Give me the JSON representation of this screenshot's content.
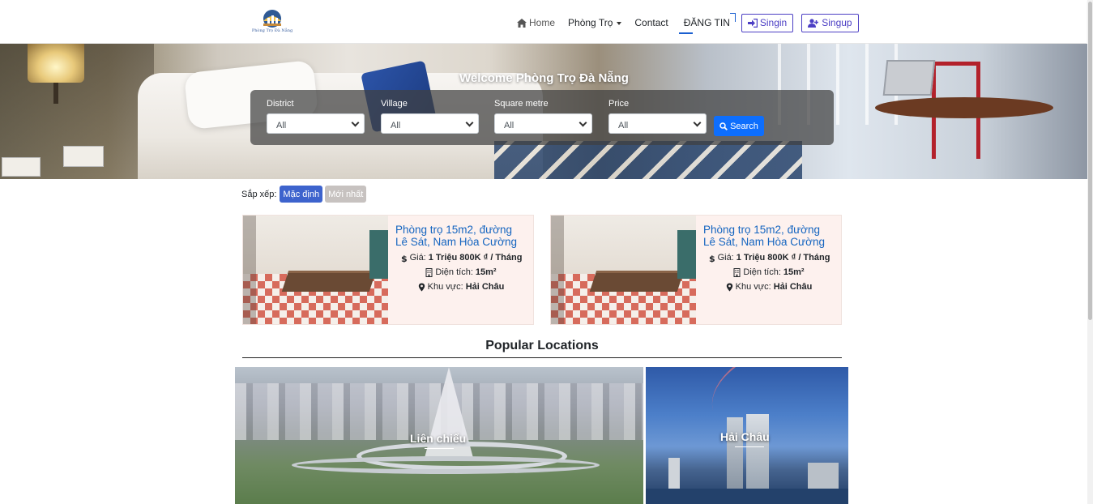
{
  "brand": {
    "logo_text": "Phòng Trọ Đà Nẵng",
    "accent": "#4c3fc4",
    "link_color": "#1565c0"
  },
  "nav": {
    "home": "Home",
    "phong_tro": "Phòng Trọ",
    "contact": "Contact",
    "dang_tin": "ĐĂNG TIN",
    "signin": "Singin",
    "signup": "Singup"
  },
  "hero": {
    "title": "Welcome Phòng Trọ Đà Nẵng",
    "search": {
      "district_label": "District",
      "district_value": "All",
      "village_label": "Village",
      "village_value": "All",
      "area_label": "Square metre",
      "area_value": "All",
      "price_label": "Price",
      "price_value": "All",
      "button_label": "Search"
    }
  },
  "sort": {
    "label": "Sắp xếp:",
    "default_label": "Mặc định",
    "newest_label": "Mới nhất"
  },
  "listings": [
    {
      "title": "Phòng trọ 15m2, đường Lê Sát, Nam Hòa Cường",
      "price_label": "Giá:",
      "price_value": "1 Triệu 800K ₫ / Tháng",
      "area_label": "Diện tích:",
      "area_value": "15m²",
      "region_label": "Khu vực:",
      "region_value": "Hải Châu"
    },
    {
      "title": "Phòng trọ 15m2, đường Lê Sát, Nam Hòa Cường",
      "price_label": "Giá:",
      "price_value": "1 Triệu 800K ₫ / Tháng",
      "area_label": "Diện tích:",
      "area_value": "15m²",
      "region_label": "Khu vực:",
      "region_value": "Hải Châu"
    }
  ],
  "popular": {
    "title": "Popular Locations",
    "locations": [
      {
        "name": "Liên chiểu"
      },
      {
        "name": "Hải Châu"
      }
    ]
  },
  "icons": {
    "home": "home-icon",
    "signin": "sign-in-icon",
    "signup": "user-plus-icon",
    "search": "search-icon",
    "price": "dollar-icon",
    "area": "building-icon",
    "region": "map-marker-icon"
  }
}
